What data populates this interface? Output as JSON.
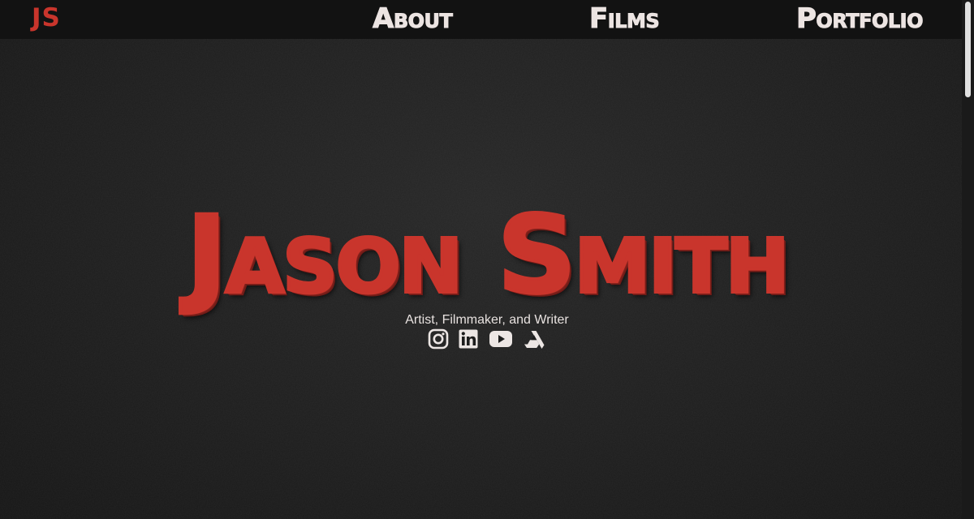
{
  "nav": {
    "logo": "JS",
    "links": [
      "About",
      "Films",
      "Portfolio"
    ]
  },
  "hero": {
    "title": "Jason Smith",
    "subtitle": "Artist, Filmmaker, and Writer"
  },
  "social": [
    {
      "icon": "instagram-icon"
    },
    {
      "icon": "linkedin-icon"
    },
    {
      "icon": "youtube-icon"
    },
    {
      "icon": "artstation-icon"
    }
  ],
  "colors": {
    "accent": "#c9352c",
    "nav_text": "#ece4e2",
    "background": "#1a1a1a",
    "navbar": "#121212"
  }
}
